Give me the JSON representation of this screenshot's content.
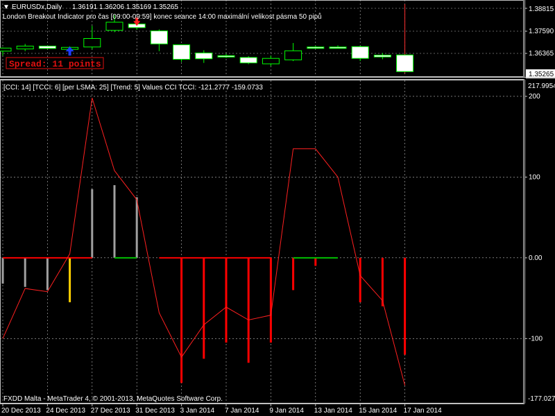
{
  "main_window": {
    "title_arrow": "▼",
    "symbol": "EURUSDx,Daily",
    "ohlc": "1.36191 1.36206 1.35169 1.35265",
    "indicator_desc": "London Breakout Indicator pro čas [09:00-09:59] konec seance 14:00 maximální velikost pásma 50 pipů",
    "spread_text": "Spread: 11 points",
    "price_labels": [
      "1.38815",
      "1.37590",
      "1.36365"
    ],
    "current_price": "1.35265",
    "colors": {
      "bull_body": "#000000",
      "bear_body": "#ffffff",
      "candle_outline": "#00ff00",
      "arrow_up": "#1e3cff",
      "arrow_down": "#ff2020"
    }
  },
  "sub_window": {
    "header": "[CCI: 14] [TCCI: 6] [per LSMA: 25] [Trend: 5] Values CCI TCCI: -121.2777 -159.0733",
    "scale_max": "217.9954",
    "scale_min": "-177.027",
    "level_labels": [
      "200",
      "100",
      "0.00",
      "-100"
    ],
    "colors": {
      "line": "#ff2020",
      "bar_red": "#ff0000",
      "bar_grey": "#a0a0a0",
      "bar_yellow": "#ffd000",
      "trend_green": "#00c000",
      "trend_red": "#ff0000"
    }
  },
  "footer_text": "FXDD Malta - MetaTrader 4, © 2001-2013, MetaQuotes Software Corp.",
  "x_axis_labels": [
    "20 Dec 2013",
    "24 Dec 2013",
    "27 Dec 2013",
    "31 Dec 2013",
    "3 Jan 2014",
    "7 Jan 2014",
    "9 Jan 2014",
    "13 Jan 2014",
    "15 Jan 2014",
    "17 Jan 2014"
  ],
  "chart_data": [
    {
      "type": "candlestick",
      "title": "EURUSDx,Daily",
      "ylim": [
        1.3505,
        1.3915
      ],
      "candles": [
        {
          "o": 1.364,
          "h": 1.366,
          "l": 1.3615,
          "c": 1.3657
        },
        {
          "o": 1.3652,
          "h": 1.368,
          "l": 1.364,
          "c": 1.3668
        },
        {
          "o": 1.3668,
          "h": 1.367,
          "l": 1.365,
          "c": 1.3655
        },
        {
          "o": 1.365,
          "h": 1.3667,
          "l": 1.364,
          "c": 1.3661
        },
        {
          "o": 1.3663,
          "h": 1.378,
          "l": 1.365,
          "c": 1.371
        },
        {
          "o": 1.3755,
          "h": 1.384,
          "l": 1.3745,
          "c": 1.38
        },
        {
          "o": 1.379,
          "h": 1.3795,
          "l": 1.3758,
          "c": 1.377
        },
        {
          "o": 1.3752,
          "h": 1.376,
          "l": 1.364,
          "c": 1.368
        },
        {
          "o": 1.3675,
          "h": 1.3675,
          "l": 1.358,
          "c": 1.3595
        },
        {
          "o": 1.363,
          "h": 1.3645,
          "l": 1.3575,
          "c": 1.3598
        },
        {
          "o": 1.3615,
          "h": 1.3625,
          "l": 1.3602,
          "c": 1.361
        },
        {
          "o": 1.3605,
          "h": 1.3612,
          "l": 1.3568,
          "c": 1.3575
        },
        {
          "o": 1.357,
          "h": 1.3615,
          "l": 1.3558,
          "c": 1.36
        },
        {
          "o": 1.3592,
          "h": 1.3685,
          "l": 1.3585,
          "c": 1.3642
        },
        {
          "o": 1.3663,
          "h": 1.367,
          "l": 1.3655,
          "c": 1.366
        },
        {
          "o": 1.3663,
          "h": 1.3672,
          "l": 1.3655,
          "c": 1.366
        },
        {
          "o": 1.3665,
          "h": 1.367,
          "l": 1.3585,
          "c": 1.36
        },
        {
          "o": 1.3618,
          "h": 1.363,
          "l": 1.3595,
          "c": 1.3608
        },
        {
          "o": 1.3619,
          "h": 1.39,
          "l": 1.3517,
          "c": 1.3527
        }
      ],
      "markers": [
        {
          "candle": 3,
          "kind": "arrow-up",
          "price": 1.3635
        },
        {
          "candle": 6,
          "kind": "arrow-down",
          "price": 1.381
        }
      ]
    },
    {
      "type": "bar+line",
      "title": "[CCI: 14] [TCCI: 6] [per LSMA: 25] [Trend: 5] Values CCI TCCI: -121.2777 -159.0733",
      "ylim": [
        -177.027,
        217.9954
      ],
      "levels": [
        200,
        100,
        0,
        -100
      ],
      "cci": [
        -32,
        -36,
        -40,
        -55,
        85,
        90,
        75,
        0,
        -155,
        -125,
        -105,
        -130,
        -105,
        -40,
        -10,
        0,
        -55,
        -60,
        -120
      ],
      "bar_colors": [
        "grey",
        "grey",
        "grey",
        "yellow",
        "grey",
        "grey",
        "grey",
        "red",
        "red",
        "red",
        "red",
        "red",
        "red",
        "red",
        "red",
        "red",
        "red",
        "red",
        "red"
      ],
      "tcci": [
        -100,
        -38,
        -42,
        5,
        198,
        108,
        72,
        -68,
        -123,
        -83,
        -61,
        -77,
        -71,
        135,
        135,
        100,
        -22,
        -53,
        -158
      ],
      "trend_segments": [
        {
          "from": 0,
          "to": 4,
          "color": "red"
        },
        {
          "from": 5,
          "to": 6,
          "color": "green"
        },
        {
          "from": 7,
          "to": 12,
          "color": "red"
        },
        {
          "from": 13,
          "to": 15,
          "color": "green"
        }
      ]
    }
  ]
}
